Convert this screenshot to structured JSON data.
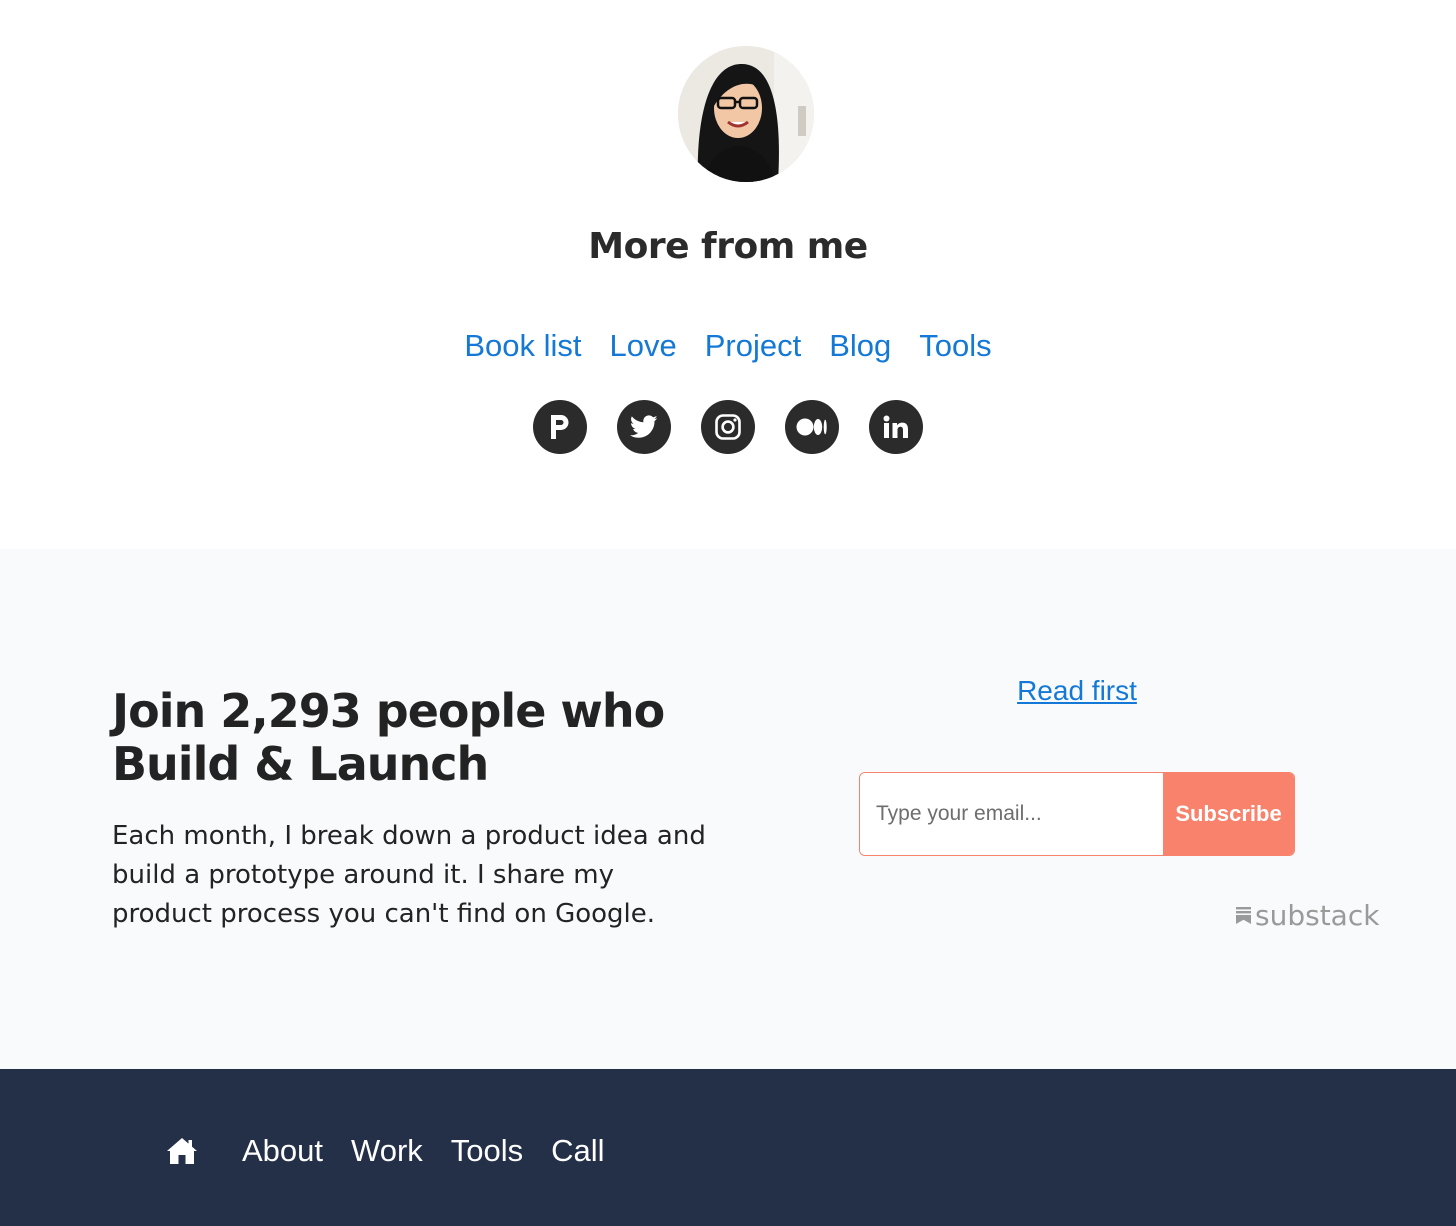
{
  "profile": {
    "avatar_alt": "profile photo"
  },
  "more": {
    "title": "More from me",
    "links": [
      "Book list",
      "Love",
      "Project",
      "Blog",
      "Tools"
    ]
  },
  "socials": [
    {
      "name": "producthunt-icon"
    },
    {
      "name": "twitter-icon"
    },
    {
      "name": "instagram-icon"
    },
    {
      "name": "medium-icon"
    },
    {
      "name": "linkedin-icon"
    }
  ],
  "subscribe": {
    "title": "Join 2,293 people who Build & Launch",
    "description": "Each month, I break down a product idea and build a prototype around it. I share my product process you can't find on Google.",
    "read_first": "Read first",
    "email_placeholder": "Type your email...",
    "button": "Subscribe",
    "brand": "substack"
  },
  "footer": {
    "nav": [
      "About",
      "Work",
      "Tools",
      "Call"
    ]
  },
  "colors": {
    "link": "#1479d6",
    "accent": "#f8826b",
    "footer_bg": "#242f48",
    "section_bg": "#f9fafc",
    "icon_bg": "#2b2b2b"
  }
}
